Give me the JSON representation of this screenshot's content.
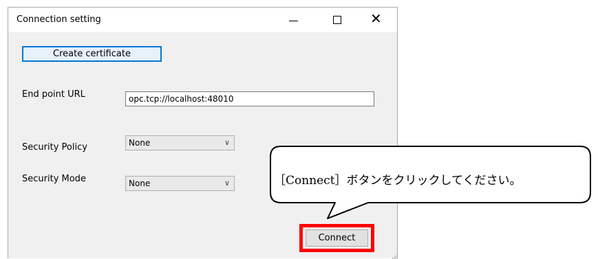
{
  "window": {
    "title": "Connection setting",
    "minimize_icon": "minimize-icon",
    "maximize_icon": "maximize-icon",
    "close_glyph": "✕"
  },
  "form": {
    "create_certificate_label": "Create certificate",
    "endpoint_label": "End point URL",
    "endpoint_value": "opc.tcp://localhost:48010",
    "security_policy_label": "Security Policy",
    "security_policy_value": "None",
    "security_mode_label": "Security Mode",
    "security_mode_value": "None",
    "dropdown_arrow": "∨",
    "connect_label": "Connect"
  },
  "callout": {
    "text": "［Connect］ボタンをクリックしてください。"
  },
  "colors": {
    "highlight": "#ff0000",
    "accent": "#0078d7",
    "window_bg": "#f0f0f0"
  }
}
